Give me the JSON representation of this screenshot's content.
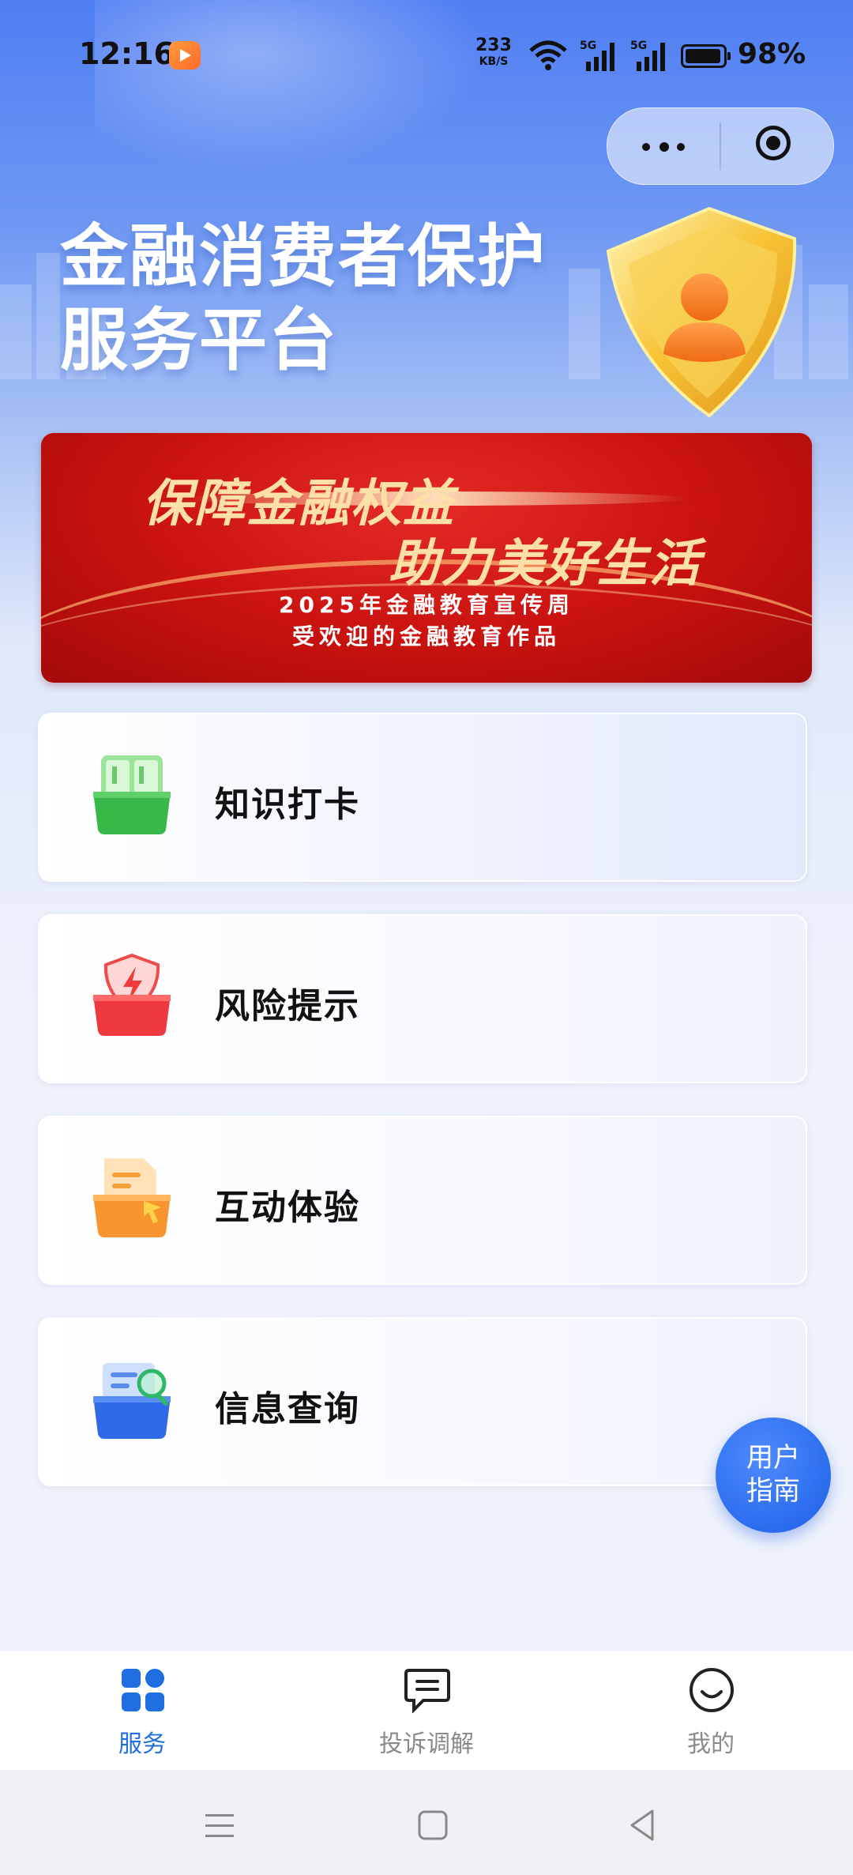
{
  "status_bar": {
    "time": "12:16",
    "net_speed": "233",
    "net_unit": "KB/S",
    "signal_label": "5G",
    "battery": "98%"
  },
  "header": {
    "title_line1": "金融消费者保护",
    "title_line2": "服务平台"
  },
  "banner": {
    "line1": "保障金融权益",
    "line2": "助力美好生活",
    "sub1": "2025年金融教育宣传周",
    "sub2": "受欢迎的金融教育作品"
  },
  "menu": [
    {
      "label": "知识打卡",
      "icon": "book-icon"
    },
    {
      "label": "风险提示",
      "icon": "risk-shield-icon"
    },
    {
      "label": "互动体验",
      "icon": "interactive-envelope-icon"
    },
    {
      "label": "信息查询",
      "icon": "search-document-icon"
    }
  ],
  "guide": {
    "line1": "用户",
    "line2": "指南"
  },
  "tabs": [
    {
      "label": "服务",
      "icon": "grid-icon",
      "active": true
    },
    {
      "label": "投诉调解",
      "icon": "message-icon",
      "active": false
    },
    {
      "label": "我的",
      "icon": "smile-icon",
      "active": false
    }
  ],
  "colors": {
    "accent": "#1f6fe0",
    "banner_red": "#c8120f",
    "banner_gold": "#fde0a8"
  }
}
